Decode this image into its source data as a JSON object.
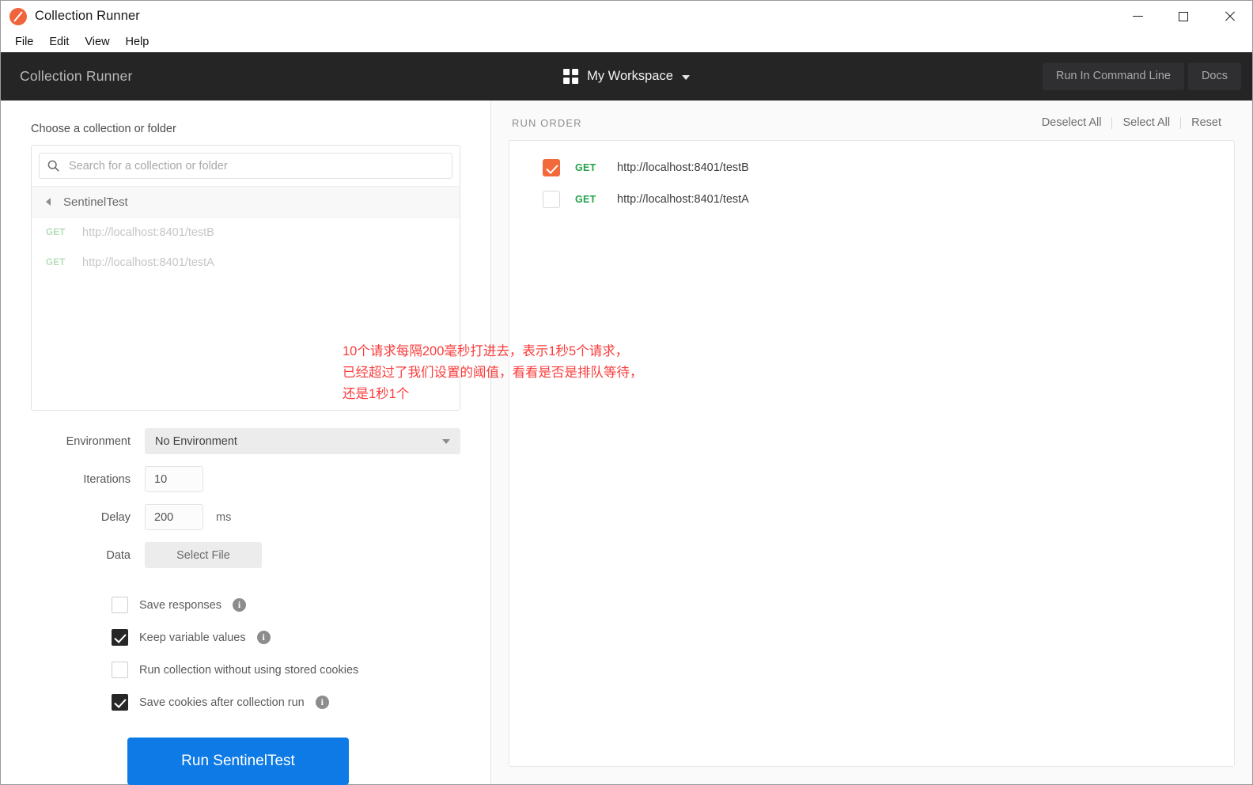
{
  "window": {
    "title": "Collection Runner",
    "logo_icon": "postman-logo-icon",
    "minimize_icon": "minimize-icon",
    "maximize_icon": "maximize-icon",
    "close_icon": "close-icon"
  },
  "menubar": {
    "items": [
      {
        "label": "File"
      },
      {
        "label": "Edit"
      },
      {
        "label": "View"
      },
      {
        "label": "Help"
      }
    ]
  },
  "header": {
    "title": "Collection Runner",
    "workspace": {
      "icon": "grid-icon",
      "name": "My Workspace",
      "caret_icon": "chevron-down-icon"
    },
    "actions": [
      {
        "label": "Run In Command Line"
      },
      {
        "label": "Docs"
      }
    ]
  },
  "left_panel": {
    "section_label": "Choose a collection or folder",
    "search": {
      "icon": "search-icon",
      "placeholder": "Search for a collection or folder",
      "value": ""
    },
    "breadcrumb": {
      "back_icon": "caret-left-icon",
      "name": "SentinelTest"
    },
    "requests": [
      {
        "method": "GET",
        "url": "http://localhost:8401/testB"
      },
      {
        "method": "GET",
        "url": "http://localhost:8401/testA"
      }
    ],
    "form": {
      "environment": {
        "label": "Environment",
        "value": "No Environment",
        "caret_icon": "chevron-down-icon"
      },
      "iterations": {
        "label": "Iterations",
        "value": "10"
      },
      "delay": {
        "label": "Delay",
        "value": "200",
        "unit": "ms"
      },
      "data": {
        "label": "Data",
        "button_label": "Select File"
      }
    },
    "checkboxes": [
      {
        "label": "Save responses",
        "checked": false,
        "info": true
      },
      {
        "label": "Keep variable values",
        "checked": true,
        "info": true
      },
      {
        "label": "Run collection without using stored cookies",
        "checked": false,
        "info": false
      },
      {
        "label": "Save cookies after collection run",
        "checked": true,
        "info": true
      }
    ],
    "run_button": {
      "label": "Run SentinelTest",
      "color": "#0e7ae6"
    }
  },
  "annotation": {
    "text": "10个请求每隔200毫秒打进去，表示1秒5个请求，\n已经超过了我们设置的阈值，看看是否是排队等待，\n还是1秒1个",
    "color": "#fa3c3c"
  },
  "right_panel": {
    "title": "RUN ORDER",
    "actions": [
      {
        "label": "Deselect All"
      },
      {
        "label": "Select All"
      },
      {
        "label": "Reset"
      }
    ],
    "items": [
      {
        "checked": true,
        "method": "GET",
        "url": "http://localhost:8401/testB"
      },
      {
        "checked": false,
        "method": "GET",
        "url": "http://localhost:8401/testA"
      }
    ]
  }
}
